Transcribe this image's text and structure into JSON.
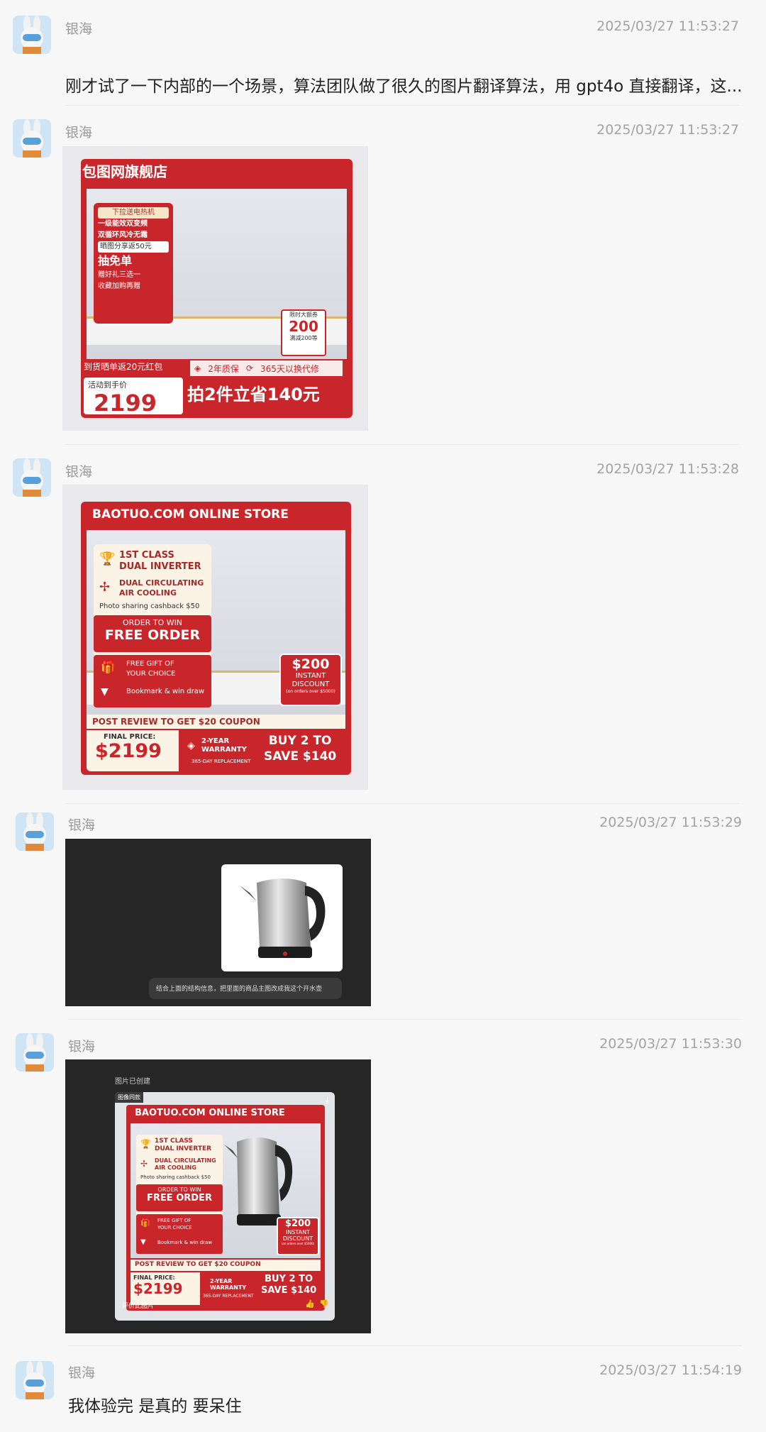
{
  "messages": [
    {
      "name": "银海",
      "time": "2025/03/27 11:53:27",
      "text": "刚才试了一下内部的一个场景，算法团队做了很久的图片翻译算法，用 gpt4o 直接翻译，这..."
    },
    {
      "name": "银海",
      "time": "2025/03/27 11:53:27"
    },
    {
      "name": "银海",
      "time": "2025/03/27 11:53:28"
    },
    {
      "name": "银海",
      "time": "2025/03/27 11:53:29"
    },
    {
      "name": "银海",
      "time": "2025/03/27 11:53:30"
    },
    {
      "name": "银海",
      "time": "2025/03/27 11:54:19",
      "text": "我体验完 是真的 要呆住"
    }
  ],
  "cn_card": {
    "store": "包图网旗舰店",
    "tag": "下拉送电热机",
    "feature1": "一级能效双变频",
    "feature2": "双循环风冷无霜",
    "share": "晒图分享返50元",
    "free": "抽免单",
    "gift": "赠好礼三选一",
    "bookmark": "收藏加购再赠",
    "coupon_label": "限时大额券",
    "coupon_value": "200",
    "coupon_sub": "满减200等",
    "review": "到货晒单返20元红包",
    "warranty": "2年质保",
    "replace": "365天以换代修",
    "price_label": "活动到手价",
    "price": "2199",
    "deal": "拍2件立省140元"
  },
  "en_card": {
    "store": "BAOTUO.COM ONLINE STORE",
    "class1": "1ST CLASS",
    "class2": "DUAL INVERTER",
    "cool1": "DUAL CIRCULATING",
    "cool2": "AIR COOLING",
    "share": "Photo sharing cashback $50",
    "order_to_win": "ORDER TO WIN",
    "free_order": "FREE ORDER",
    "gift1": "FREE GIFT OF",
    "gift2": "YOUR CHOICE",
    "bookmark": "Bookmark & win draw",
    "discount_value": "$200",
    "discount1": "INSTANT",
    "discount2": "DISCOUNT",
    "discount_note": "(on orders over $5000)",
    "review": "POST REVIEW TO GET $20 COUPON",
    "final_label": "FINAL PRICE:",
    "final_price": "$2199",
    "warranty1": "2-YEAR",
    "warranty2": "WARRANTY",
    "replacement": "365-DAY REPLACEMENT",
    "deal1": "BUY 2 TO",
    "deal2": "SAVE $140"
  },
  "kettle_shot": {
    "caption": "结合上面的结构信息，把里面的商品主图改成我这个开水壶"
  },
  "result_shot": {
    "created": "图片已创建",
    "badge": "图像同款",
    "rate": "评价此图片"
  },
  "colors": {
    "accent_red": "#c9262b",
    "dark_bg": "#262626"
  }
}
